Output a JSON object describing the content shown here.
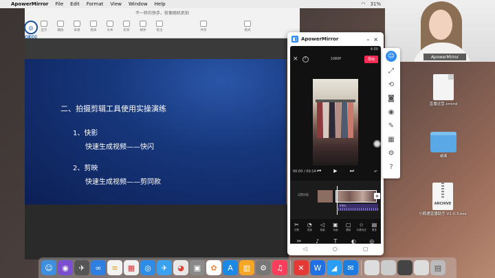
{
  "menubar": {
    "app_name": "ApowerMirror",
    "items": [
      "File",
      "Edit",
      "Format",
      "View",
      "Window",
      "Help"
    ],
    "battery": "31%"
  },
  "logo": {
    "text": "CIECC"
  },
  "webcam": {
    "label": "ApowerMirror"
  },
  "presentation": {
    "title_hint": "不一样的快手，就像随机抓拍",
    "toolbar": [
      "显示",
      "播放",
      "表格",
      "图表",
      "文本",
      "形状",
      "媒体",
      "批注",
      "共享"
    ],
    "toolbar_right": "格式",
    "slide": {
      "heading": "二、拍摄剪辑工具使用实操演练",
      "item1_title": "1、快影",
      "item1_desc": "快速生成视频——快闪",
      "item2_title": "2、剪映",
      "item2_desc": "快速生成视频——剪同款"
    }
  },
  "mirror": {
    "title": "ApowerMirror",
    "phone": {
      "status_right": "4:00",
      "resolution": "1080P",
      "export_label": "导出",
      "help_label": "?",
      "time": "00:00 / 00:14",
      "cover_label": "设置封面",
      "audio_label": "Intro",
      "tools_row1": [
        {
          "icon": "scissors",
          "label": "分割"
        },
        {
          "icon": "speed",
          "label": "变速"
        },
        {
          "icon": "volume",
          "label": "音量"
        },
        {
          "icon": "animation",
          "label": "动画"
        },
        {
          "icon": "delete",
          "label": "删除"
        },
        {
          "icon": "effect",
          "label": "抖音玩法"
        },
        {
          "icon": "more",
          "label": "更多"
        }
      ],
      "tools_row2": [
        {
          "icon": "edit",
          "label": "剪辑"
        },
        {
          "icon": "audio",
          "label": "音频"
        },
        {
          "icon": "text",
          "label": "文字"
        },
        {
          "icon": "sticker",
          "label": "贴纸"
        },
        {
          "icon": "filter",
          "label": "滤镜"
        }
      ]
    }
  },
  "desktop_icons": [
    {
      "label": "直播运营.xmind",
      "type": "doc"
    },
    {
      "label": "桌面",
      "type": "folder"
    },
    {
      "label": "小鹅通直播助手 V1.0.3.exe",
      "type": "archive",
      "badge": "ARCHIVE"
    }
  ],
  "colors": {
    "accent": "#2f8cf0",
    "export": "#fe2c55",
    "slide_bg": "#17377c"
  }
}
